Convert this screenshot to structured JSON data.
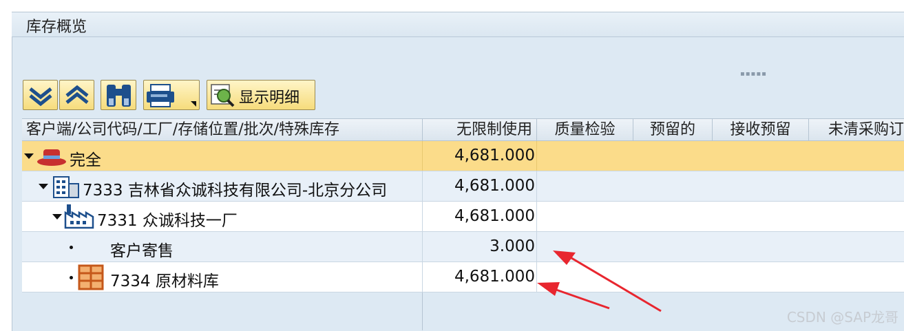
{
  "window": {
    "title": "库存概览"
  },
  "toolbar": {
    "expand_icon": "expand-all-icon",
    "collapse_icon": "collapse-all-icon",
    "find_icon": "binoculars-icon",
    "print_icon": "printer-icon",
    "detail_label": "显示明细"
  },
  "table": {
    "columns": [
      "客户端/公司代码/工厂/存储位置/批次/特殊库存",
      "无限制使用",
      "质量检验",
      "预留的",
      "接收预留",
      "未清采购订"
    ],
    "rows": [
      {
        "label": "完全",
        "value": "4,681.000",
        "icon": "hat-icon",
        "highlight": "#fbdc8a"
      },
      {
        "label": "7333 吉林省众诚科技有限公司-北京分公司",
        "value": "4,681.000",
        "icon": "company-building-icon"
      },
      {
        "label": "7331 众诚科技一厂",
        "value": "4,681.000",
        "icon": "factory-icon"
      },
      {
        "label": "客户寄售",
        "value": "3.000",
        "icon": ""
      },
      {
        "label": "7334 原材料库",
        "value": "4,681.000",
        "icon": "warehouse-shelf-icon"
      }
    ]
  },
  "annotation": {
    "arrow_color": "#e8262f"
  },
  "watermark": "CSDN @SAP龙哥"
}
